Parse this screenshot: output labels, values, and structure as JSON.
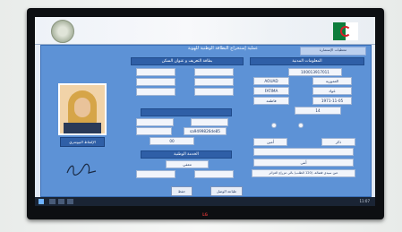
{
  "banner": {
    "title": "",
    "subtitle": ""
  },
  "page": {
    "heading": "عملية إستخراج البطاقة الوطنية للهوية",
    "breadcrumb": "معطيات الإستمارة"
  },
  "sections": {
    "civil": "المعلومات المدنية",
    "card_address": "بطاقة التعريف و عنوان السكن",
    "middle": "",
    "national_service": "الخدمة الوطنية"
  },
  "civil_fields": {
    "nin": "100013917011",
    "wilaya_ar": "العمورية",
    "surname_latin": "AOUAD",
    "surname_ar": "عواد",
    "firstname_latin": "FATIMA",
    "firstname_ar": "فاطمة",
    "birth_date": "1971-11-05",
    "gender": "أنثى",
    "birth_code": "14",
    "father": "ذكر",
    "mother": "أمين",
    "birthplace": "",
    "doc_number": "sa9499826de85",
    "number": "00",
    "place_full": "عين سيدي فضالة، (120 الطلب) بالي مزراع العزائر"
  },
  "national_service_fields": {
    "status": "معفي"
  },
  "buttons": {
    "biometric": "الإلتقاط البيومتري",
    "save": "حفظ",
    "print": "طباعة الوصل"
  },
  "taskbar": {
    "clock": "11:07"
  },
  "tv": {
    "brand": "LG"
  }
}
